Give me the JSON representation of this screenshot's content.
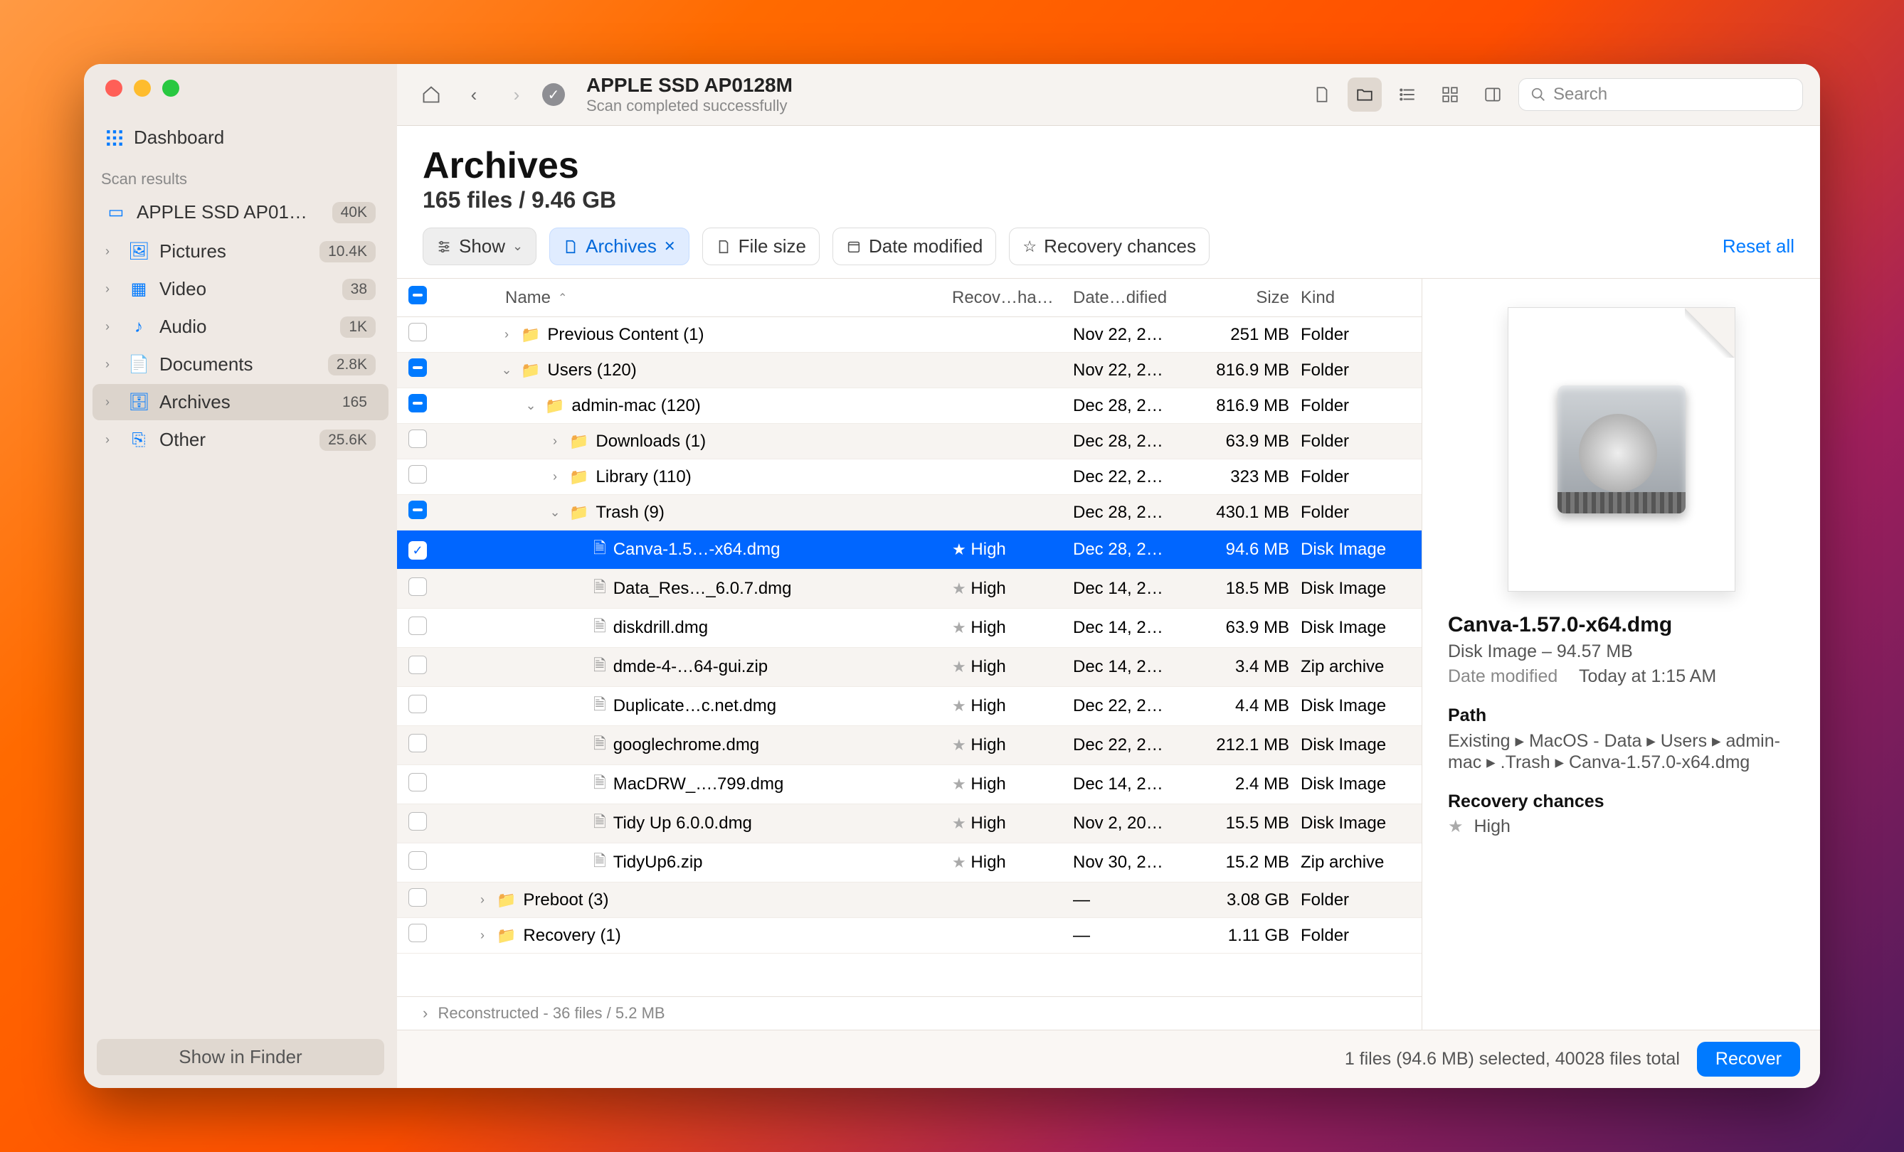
{
  "window": {
    "title": "APPLE SSD AP0128M",
    "subtitle": "Scan completed successfully",
    "search_placeholder": "Search"
  },
  "sidebar": {
    "dashboard_label": "Dashboard",
    "scan_section": "Scan results",
    "device": {
      "label": "APPLE SSD AP01…",
      "badge": "40K"
    },
    "items": [
      {
        "label": "Pictures",
        "badge": "10.4K"
      },
      {
        "label": "Video",
        "badge": "38"
      },
      {
        "label": "Audio",
        "badge": "1K"
      },
      {
        "label": "Documents",
        "badge": "2.8K"
      },
      {
        "label": "Archives",
        "badge": "165"
      },
      {
        "label": "Other",
        "badge": "25.6K"
      }
    ],
    "show_finder": "Show in Finder"
  },
  "heading": {
    "title": "Archives",
    "subtitle": "165 files / 9.46 GB"
  },
  "filters": {
    "show": "Show",
    "archives": "Archives",
    "file_size": "File size",
    "date_modified": "Date modified",
    "recovery_chances": "Recovery chances",
    "reset": "Reset all"
  },
  "columns": {
    "name": "Name",
    "recovery": "Recov…hances",
    "date": "Date…dified",
    "size": "Size",
    "kind": "Kind"
  },
  "rows": [
    {
      "indent": 1,
      "disclosure": "right",
      "checkbox": "none",
      "icon": "folder",
      "name": "Previous Content (1)",
      "recovery": "",
      "date": "Nov 22, 2…",
      "size": "251 MB",
      "kind": "Folder",
      "sel": false
    },
    {
      "indent": 1,
      "disclosure": "down",
      "checkbox": "ind",
      "icon": "folder",
      "name": "Users (120)",
      "recovery": "",
      "date": "Nov 22, 2…",
      "size": "816.9 MB",
      "kind": "Folder",
      "sel": false
    },
    {
      "indent": 2,
      "disclosure": "down",
      "checkbox": "ind",
      "icon": "folder",
      "name": "admin-mac (120)",
      "recovery": "",
      "date": "Dec 28, 2…",
      "size": "816.9 MB",
      "kind": "Folder",
      "sel": false
    },
    {
      "indent": 3,
      "disclosure": "right",
      "checkbox": "none",
      "icon": "folder",
      "name": "Downloads (1)",
      "recovery": "",
      "date": "Dec 28, 2…",
      "size": "63.9 MB",
      "kind": "Folder",
      "sel": false
    },
    {
      "indent": 3,
      "disclosure": "right",
      "checkbox": "none",
      "icon": "folder",
      "name": "Library (110)",
      "recovery": "",
      "date": "Dec 22, 2…",
      "size": "323 MB",
      "kind": "Folder",
      "sel": false
    },
    {
      "indent": 3,
      "disclosure": "down",
      "checkbox": "ind",
      "icon": "folder",
      "name": "Trash (9)",
      "recovery": "",
      "date": "Dec 28, 2…",
      "size": "430.1 MB",
      "kind": "Folder",
      "sel": false
    },
    {
      "indent": 4,
      "disclosure": "",
      "checkbox": "chk",
      "icon": "file",
      "name": "Canva-1.5…-x64.dmg",
      "recovery": "High",
      "date": "Dec 28, 2…",
      "size": "94.6 MB",
      "kind": "Disk Image",
      "sel": true
    },
    {
      "indent": 4,
      "disclosure": "",
      "checkbox": "none",
      "icon": "file",
      "name": "Data_Res…_6.0.7.dmg",
      "recovery": "High",
      "date": "Dec 14, 2…",
      "size": "18.5 MB",
      "kind": "Disk Image",
      "sel": false
    },
    {
      "indent": 4,
      "disclosure": "",
      "checkbox": "none",
      "icon": "file",
      "name": "diskdrill.dmg",
      "recovery": "High",
      "date": "Dec 14, 2…",
      "size": "63.9 MB",
      "kind": "Disk Image",
      "sel": false
    },
    {
      "indent": 4,
      "disclosure": "",
      "checkbox": "none",
      "icon": "file",
      "name": "dmde-4-…64-gui.zip",
      "recovery": "High",
      "date": "Dec 14, 2…",
      "size": "3.4 MB",
      "kind": "Zip archive",
      "sel": false
    },
    {
      "indent": 4,
      "disclosure": "",
      "checkbox": "none",
      "icon": "file",
      "name": "Duplicate…c.net.dmg",
      "recovery": "High",
      "date": "Dec 22, 2…",
      "size": "4.4 MB",
      "kind": "Disk Image",
      "sel": false
    },
    {
      "indent": 4,
      "disclosure": "",
      "checkbox": "none",
      "icon": "file",
      "name": "googlechrome.dmg",
      "recovery": "High",
      "date": "Dec 22, 2…",
      "size": "212.1 MB",
      "kind": "Disk Image",
      "sel": false
    },
    {
      "indent": 4,
      "disclosure": "",
      "checkbox": "none",
      "icon": "file",
      "name": "MacDRW_….799.dmg",
      "recovery": "High",
      "date": "Dec 14, 2…",
      "size": "2.4 MB",
      "kind": "Disk Image",
      "sel": false
    },
    {
      "indent": 4,
      "disclosure": "",
      "checkbox": "none",
      "icon": "file",
      "name": "Tidy Up 6.0.0.dmg",
      "recovery": "High",
      "date": "Nov 2, 20…",
      "size": "15.5 MB",
      "kind": "Disk Image",
      "sel": false
    },
    {
      "indent": 4,
      "disclosure": "",
      "checkbox": "none",
      "icon": "file",
      "name": "TidyUp6.zip",
      "recovery": "High",
      "date": "Nov 30, 2…",
      "size": "15.2 MB",
      "kind": "Zip archive",
      "sel": false
    },
    {
      "indent": 0,
      "disclosure": "right",
      "checkbox": "none",
      "icon": "folder",
      "name": "Preboot (3)",
      "recovery": "",
      "date": "—",
      "size": "3.08 GB",
      "kind": "Folder",
      "sel": false
    },
    {
      "indent": 0,
      "disclosure": "right",
      "checkbox": "none",
      "icon": "folder",
      "name": "Recovery (1)",
      "recovery": "",
      "date": "—",
      "size": "1.11 GB",
      "kind": "Folder",
      "sel": false
    }
  ],
  "reconstructed": "Reconstructed - 36 files / 5.2 MB",
  "footer": {
    "status": "1 files (94.6 MB) selected, 40028 files total",
    "recover": "Recover"
  },
  "inspector": {
    "title": "Canva-1.57.0-x64.dmg",
    "type_size": "Disk Image – 94.57 MB",
    "date_label": "Date modified",
    "date_value": "Today at 1:15 AM",
    "path_label": "Path",
    "path_value": "Existing ▸ MacOS - Data ▸ Users ▸ admin-mac ▸ .Trash ▸ Canva-1.57.0-x64.dmg",
    "recovery_label": "Recovery chances",
    "recovery_value": "High"
  }
}
